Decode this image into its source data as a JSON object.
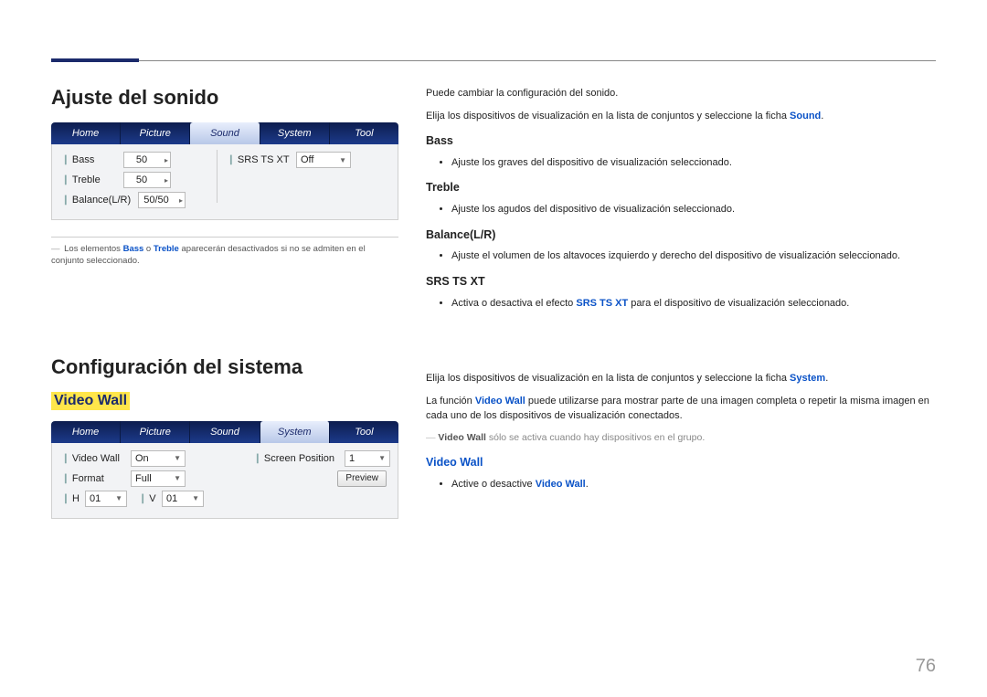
{
  "page_number": "76",
  "section1": {
    "title": "Ajuste del sonido",
    "tabs": [
      "Home",
      "Picture",
      "Sound",
      "System",
      "Tool"
    ],
    "active_tab_index": 2,
    "fields": {
      "bass_label": "Bass",
      "bass_value": "50",
      "treble_label": "Treble",
      "treble_value": "50",
      "balance_label": "Balance(L/R)",
      "balance_value": "50/50",
      "srs_label": "SRS TS XT",
      "srs_value": "Off"
    },
    "footnote_pre": "Los elementos ",
    "footnote_kw1": "Bass",
    "footnote_mid1": " o ",
    "footnote_kw2": "Treble",
    "footnote_post": " aparecerán desactivados si no se admiten en el conjunto seleccionado.",
    "rt_intro1": "Puede cambiar la configuración del sonido.",
    "rt_intro2_a": "Elija los dispositivos de visualización en la lista de conjuntos y seleccione la ficha ",
    "rt_intro2_kw": "Sound",
    "rt_intro2_b": ".",
    "h_bass": "Bass",
    "p_bass": "Ajuste los graves del dispositivo de visualización seleccionado.",
    "h_treble": "Treble",
    "p_treble": "Ajuste los agudos del dispositivo de visualización seleccionado.",
    "h_bal": "Balance(L/R)",
    "p_bal": "Ajuste el volumen de los altavoces izquierdo y derecho del dispositivo de visualización seleccionado.",
    "h_srs": "SRS TS XT",
    "p_srs_a": "Activa o desactiva el efecto ",
    "p_srs_kw": "SRS TS XT",
    "p_srs_b": " para el dispositivo de visualización seleccionado."
  },
  "section2": {
    "title": "Configuración del sistema",
    "subheading": "Video Wall",
    "tabs": [
      "Home",
      "Picture",
      "Sound",
      "System",
      "Tool"
    ],
    "active_tab_index": 3,
    "fields": {
      "vw_label": "Video Wall",
      "vw_value": "On",
      "fmt_label": "Format",
      "fmt_value": "Full",
      "h_label": "H",
      "h_value": "01",
      "v_label": "V",
      "v_value": "01",
      "sp_label": "Screen Position",
      "sp_value": "1",
      "preview": "Preview"
    },
    "rt_intro1_a": "Elija los dispositivos de visualización en la lista de conjuntos y seleccione la ficha ",
    "rt_intro1_kw": "System",
    "rt_intro1_b": ".",
    "rt_intro2_a": "La función ",
    "rt_intro2_kw": "Video Wall",
    "rt_intro2_b": " puede utilizarse para mostrar parte de una imagen completa o repetir la misma imagen en cada uno de los dispositivos de visualización conectados.",
    "note_kw": "Video Wall",
    "note_text": " sólo se activa cuando hay dispositivos en el grupo.",
    "h_vw": "Video Wall",
    "p_vw_a": "Active o desactive ",
    "p_vw_kw": "Video Wall",
    "p_vw_b": "."
  }
}
